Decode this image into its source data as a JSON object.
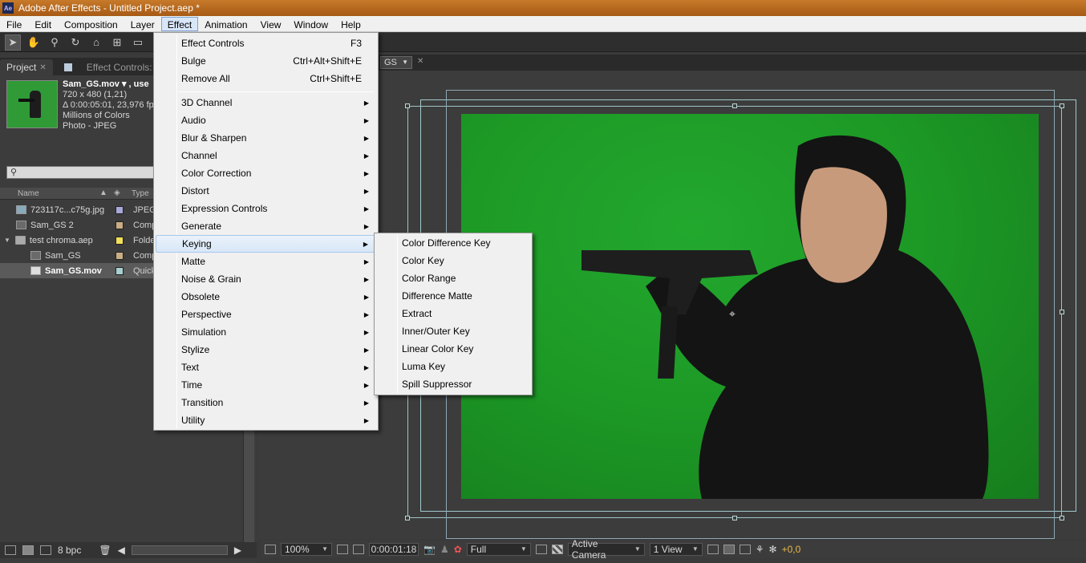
{
  "window": {
    "title": "Adobe After Effects - Untitled Project.aep *",
    "app_icon": "Ae"
  },
  "menubar": {
    "items": [
      "File",
      "Edit",
      "Composition",
      "Layer",
      "Effect",
      "Animation",
      "View",
      "Window",
      "Help"
    ],
    "active": "Effect"
  },
  "project_panel": {
    "tabs": [
      {
        "label": "Project"
      },
      {
        "label": "Effect Controls:"
      }
    ],
    "selected_item": {
      "name": "Sam_GS.mov ▾ , use",
      "dimensions": "720 x 480 (1,21)",
      "duration": "Δ 0:00:05:01, 23,976 fp",
      "colors": "Millions of Colors",
      "codec": "Photo - JPEG"
    },
    "columns": {
      "name": "Name",
      "type": "Type"
    },
    "items": [
      {
        "name": "723117c...c75g.jpg",
        "type": "JPEG",
        "swatch": "#a8a8d8",
        "icon": "image-icon"
      },
      {
        "name": "Sam_GS 2",
        "type": "Comp",
        "swatch": "#c9ad85",
        "icon": "composition-icon"
      },
      {
        "name": "test chroma.aep",
        "type": "Folde",
        "swatch": "#f2e05a",
        "icon": "folder-icon"
      },
      {
        "name": "Sam_GS",
        "type": "Comp",
        "swatch": "#c9ad85",
        "icon": "composition-icon"
      },
      {
        "name": "Sam_GS.mov",
        "type": "Quick",
        "swatch": "#a8d0d0",
        "icon": "footage-icon"
      }
    ],
    "bit_depth": "8 bpc"
  },
  "composition_panel": {
    "tab_label": "GS",
    "zoom": "100%",
    "timecode": "0:00:01:18",
    "resolution": "Full",
    "camera": "Active Camera",
    "views": "1 View",
    "exposure": "+0,0",
    "accent_green": "#1d9a26"
  },
  "effect_menu": {
    "top_items": [
      {
        "label": "Effect Controls",
        "shortcut": "F3"
      },
      {
        "label": "Bulge",
        "shortcut": "Ctrl+Alt+Shift+E"
      },
      {
        "label": "Remove All",
        "shortcut": "Ctrl+Shift+E"
      }
    ],
    "categories": [
      "3D Channel",
      "Audio",
      "Blur & Sharpen",
      "Channel",
      "Color Correction",
      "Distort",
      "Expression Controls",
      "Generate",
      "Keying",
      "Matte",
      "Noise & Grain",
      "Obsolete",
      "Perspective",
      "Simulation",
      "Stylize",
      "Text",
      "Time",
      "Transition",
      "Utility"
    ],
    "highlighted": "Keying"
  },
  "keying_submenu": {
    "items": [
      "Color Difference Key",
      "Color Key",
      "Color Range",
      "Difference Matte",
      "Extract",
      "Inner/Outer Key",
      "Linear Color Key",
      "Luma Key",
      "Spill Suppressor"
    ]
  }
}
